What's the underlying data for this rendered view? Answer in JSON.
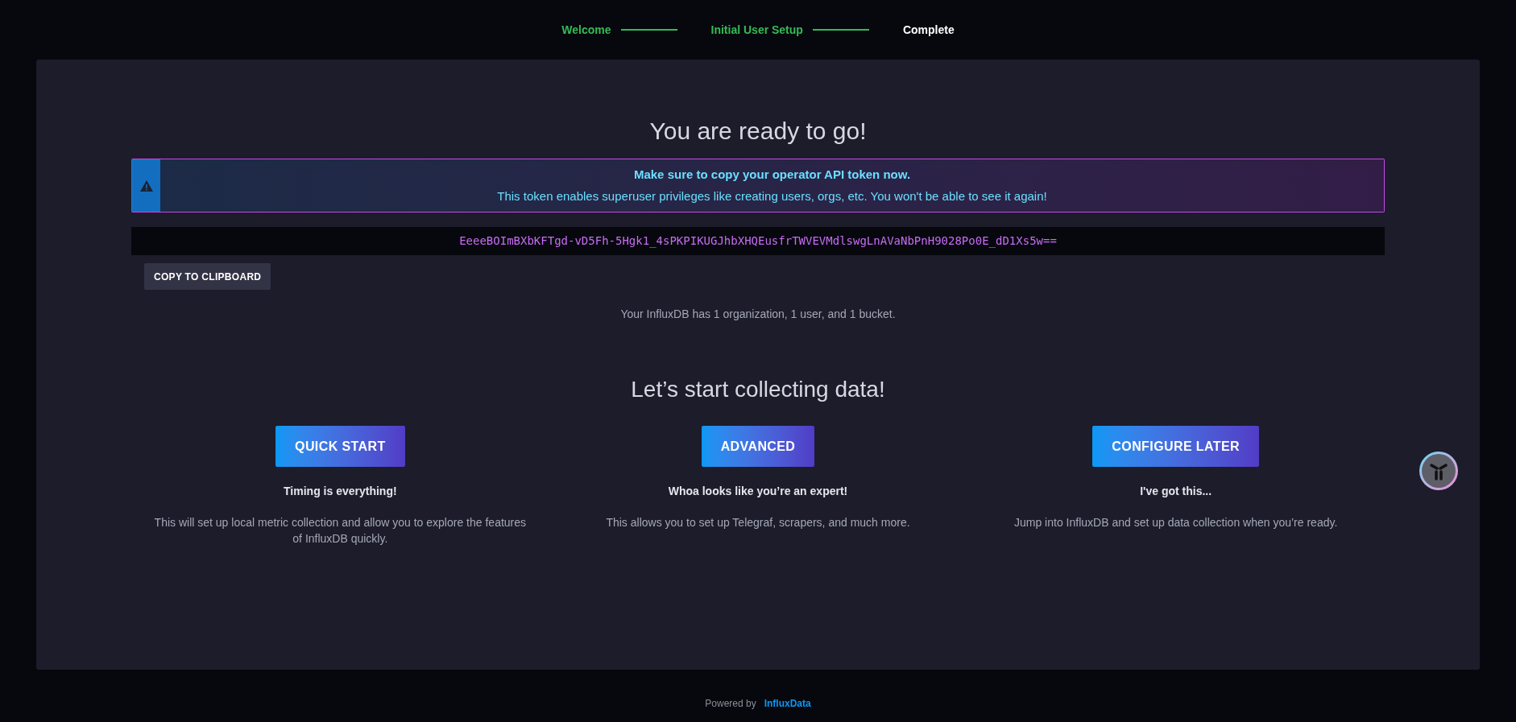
{
  "steps": [
    {
      "label": "Welcome",
      "completed": true
    },
    {
      "label": "Initial User Setup",
      "completed": true
    },
    {
      "label": "Complete",
      "completed": false
    }
  ],
  "title": "You are ready to go!",
  "alert": {
    "heading": "Make sure to copy your operator API token now.",
    "text": "This token enables superuser privileges like creating users, orgs, etc. You won't be able to see it again!"
  },
  "token": "EeeeBOImBXbKFTgd-vD5Fh-5Hgk1_4sPKPIKUGJhbXHQEusfrTWVEVMdlswgLnAVaNbPnH9028Po0E_dD1Xs5w==",
  "copy_button": "COPY TO CLIPBOARD",
  "summary": "Your InfluxDB has 1 organization, 1 user, and 1 bucket.",
  "collect_heading": "Let’s start collecting data!",
  "options": [
    {
      "button": "QUICK START",
      "heading": "Timing is everything!",
      "text": "This will set up local metric collection and allow you to explore the features of InfluxDB quickly."
    },
    {
      "button": "ADVANCED",
      "heading": "Whoa looks like you’re an expert!",
      "text": "This allows you to set up Telegraf, scrapers, and much more."
    },
    {
      "button": "CONFIGURE LATER",
      "heading": "I've got this...",
      "text": "Jump into InfluxDB and set up data collection when you’re ready."
    }
  ],
  "footer": {
    "prefix": "Powered by",
    "brand": "InfluxData"
  }
}
